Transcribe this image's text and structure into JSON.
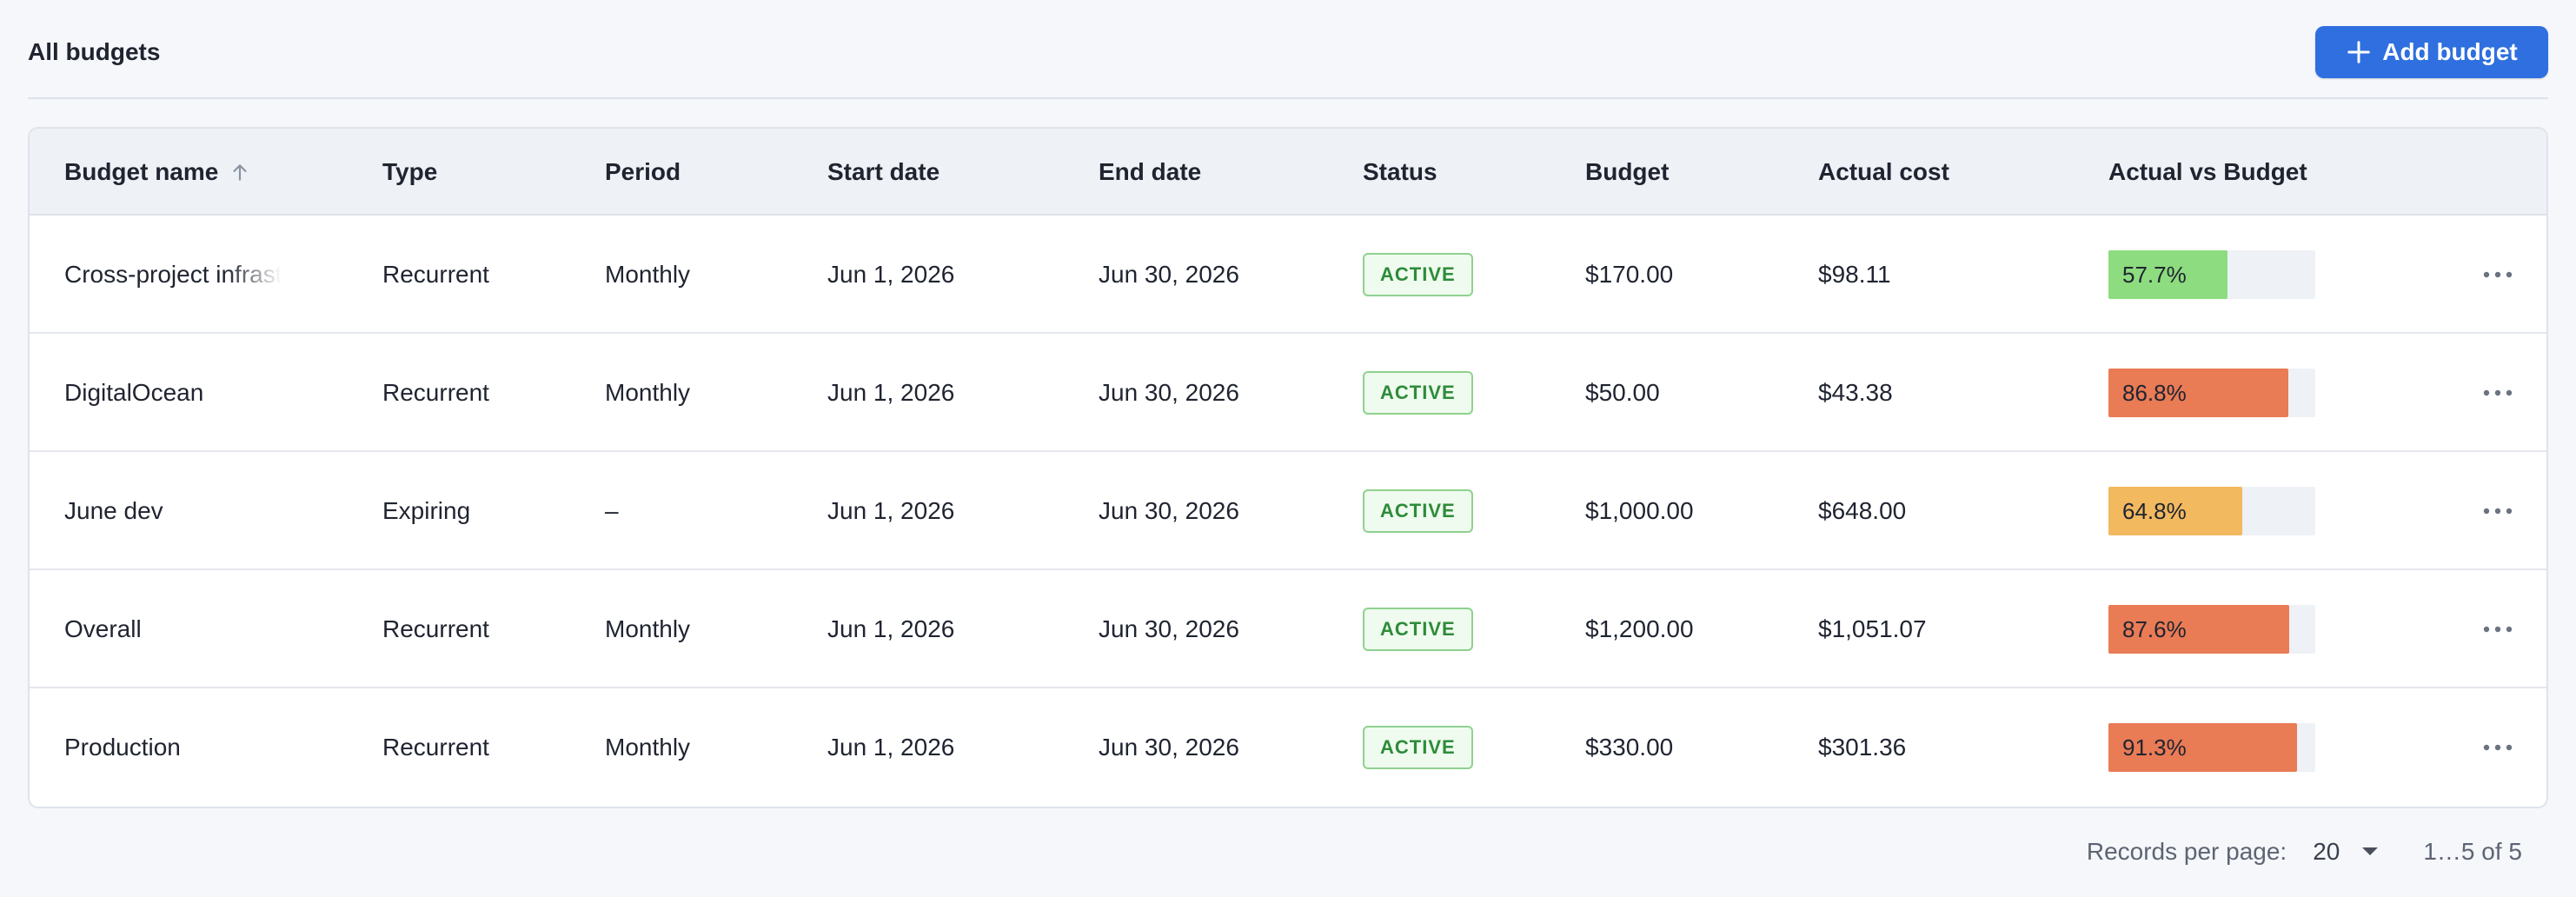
{
  "header": {
    "title": "All budgets",
    "add_button_label": "Add budget"
  },
  "table": {
    "columns": [
      "Budget name",
      "Type",
      "Period",
      "Start date",
      "End date",
      "Status",
      "Budget",
      "Actual cost",
      "Actual vs Budget"
    ],
    "sort": {
      "column": "Budget name",
      "direction": "ascending"
    },
    "rows": [
      {
        "name": "Cross-project infrastructure",
        "type": "Recurrent",
        "period": "Monthly",
        "start": "Jun 1, 2026",
        "end": "Jun 30, 2026",
        "status": "ACTIVE",
        "budget": "$170.00",
        "actual": "$98.11",
        "pct_label": "57.7%",
        "pct": 57.7,
        "color": "#8ddc7f"
      },
      {
        "name": "DigitalOcean",
        "type": "Recurrent",
        "period": "Monthly",
        "start": "Jun 1, 2026",
        "end": "Jun 30, 2026",
        "status": "ACTIVE",
        "budget": "$50.00",
        "actual": "$43.38",
        "pct_label": "86.8%",
        "pct": 86.8,
        "color": "#e97b55"
      },
      {
        "name": "June dev",
        "type": "Expiring",
        "period": "–",
        "start": "Jun 1, 2026",
        "end": "Jun 30, 2026",
        "status": "ACTIVE",
        "budget": "$1,000.00",
        "actual": "$648.00",
        "pct_label": "64.8%",
        "pct": 64.8,
        "color": "#f3b95f"
      },
      {
        "name": "Overall",
        "type": "Recurrent",
        "period": "Monthly",
        "start": "Jun 1, 2026",
        "end": "Jun 30, 2026",
        "status": "ACTIVE",
        "budget": "$1,200.00",
        "actual": "$1,051.07",
        "pct_label": "87.6%",
        "pct": 87.6,
        "color": "#e97b55"
      },
      {
        "name": "Production",
        "type": "Recurrent",
        "period": "Monthly",
        "start": "Jun 1, 2026",
        "end": "Jun 30, 2026",
        "status": "ACTIVE",
        "budget": "$330.00",
        "actual": "$301.36",
        "pct_label": "91.3%",
        "pct": 91.3,
        "color": "#e97b55"
      }
    ]
  },
  "pagination": {
    "records_label": "Records per page:",
    "per_page": "20",
    "range": "1…5 of 5"
  },
  "colors": {
    "accent": "#2f6fdf",
    "status_active_text": "#2e8b3a",
    "status_active_border": "#8fd18f"
  },
  "icons": {
    "add": "plus-icon",
    "sort": "arrow-up-icon",
    "row_menu": "more-horizontal-icon",
    "select": "caret-down-icon"
  }
}
